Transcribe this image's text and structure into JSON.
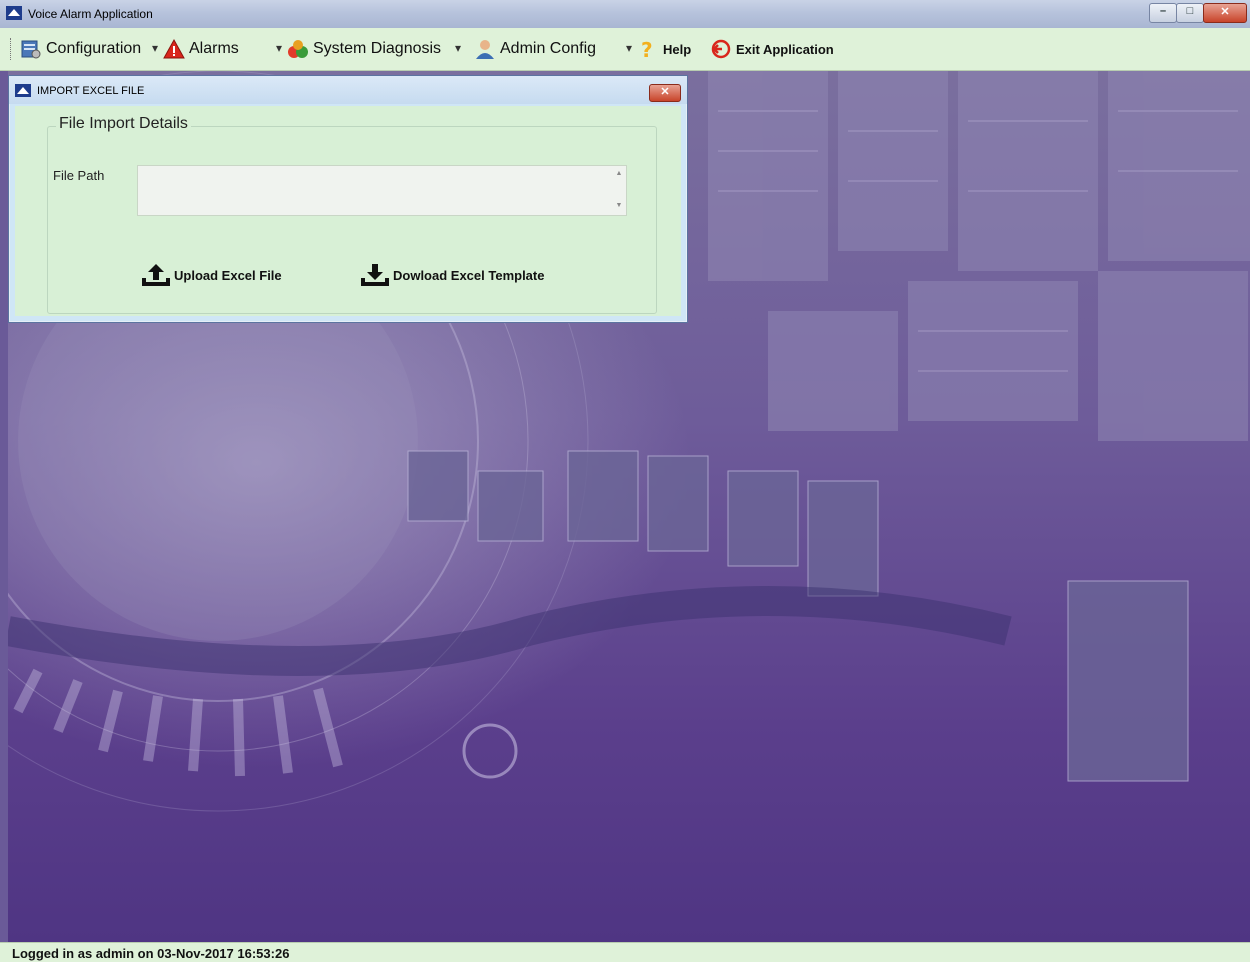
{
  "window": {
    "title": "Voice Alarm Application"
  },
  "menu": {
    "items": [
      {
        "label": "Configuration",
        "icon": "configuration-icon"
      },
      {
        "label": "Alarms",
        "icon": "alarm-warning-icon"
      },
      {
        "label": "System Diagnosis",
        "icon": "system-diagnosis-icon"
      },
      {
        "label": "Admin Config",
        "icon": "admin-user-icon"
      },
      {
        "label": "Help",
        "icon": "help-question-icon"
      },
      {
        "label": "Exit Application",
        "icon": "exit-icon"
      }
    ]
  },
  "dialog": {
    "title": "IMPORT EXCEL FILE",
    "group_title": "File Import Details",
    "file_path_label": "File Path",
    "file_path_value": "",
    "upload_label": "Upload Excel File",
    "download_label": "Dowload Excel Template"
  },
  "status": {
    "text": "Logged in as admin on 03-Nov-2017 16:53:26"
  },
  "colors": {
    "menubar": "#dff2d9",
    "dialog_body": "#d8f0d6",
    "desktop": "#5b3f8c"
  }
}
